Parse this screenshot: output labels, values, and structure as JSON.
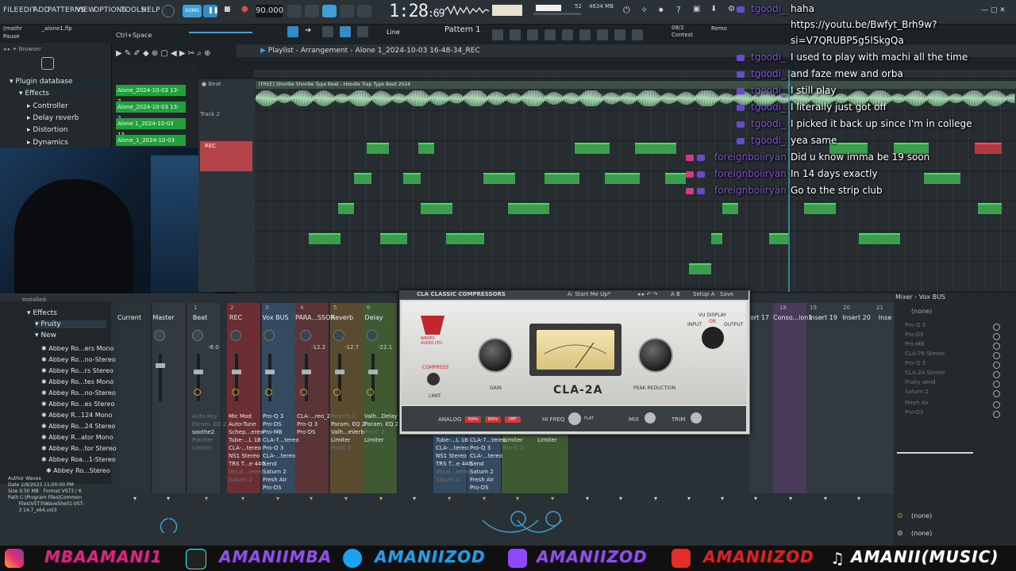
{
  "menu": [
    "FILE",
    "EDIT",
    "ADD",
    "PATTERNS",
    "VIEW",
    "OPTIONS",
    "TOOLS",
    "HELP"
  ],
  "song_label": "SONG",
  "tempo": "90.000",
  "time": {
    "main": "1:28",
    "ms": ":69"
  },
  "memory": {
    "mb": "4634 MB",
    "cpu": "52"
  },
  "project": {
    "user": "(mathr",
    "file": "_alone1.flp"
  },
  "status": "Pause",
  "hint": "Ctrl+Space",
  "toolbar": {
    "snap": "Line",
    "pattern": "Pattern 1",
    "contest": "Contest",
    "date": "08/2",
    "remote": "Remo"
  },
  "browser": {
    "title": "Browser",
    "items": [
      "Plugin database",
      "Effects",
      "Controller",
      "Delay reverb",
      "Distortion",
      "Dynamics"
    ]
  },
  "clips": [
    "Alone_2024-10-03 13-2...",
    "Alone_2024-10-03 13-2...",
    "Alone 1_2024-10-03 13...",
    "Alone_1_2024-10-03 11..."
  ],
  "playlist": {
    "title": "Playlist - Arrangement",
    "file": "Alone 1_2024-10-03 16-48-34_REC",
    "track_beat": "Beat",
    "track2": "Track 2",
    "rec_label": "REC",
    "audio_name": "[FREE] Shordie Shordie Type Beat - Hoodie  Trap Type Beat 2024"
  },
  "chat": [
    {
      "name": "tgoodi_",
      "msg": "haha"
    },
    {
      "name": "",
      "msg": "https://youtu.be/Bwfyt_Brh9w?"
    },
    {
      "name": "",
      "msg": "si=V7QRUBP5g5lSkgQa"
    },
    {
      "name": "tgoodi_",
      "msg": "I used to play with machi all the time"
    },
    {
      "name": "tgoodi_",
      "msg": "and faze mew and orba"
    },
    {
      "name": "tgoodi_",
      "msg": "I still play"
    },
    {
      "name": "tgoodi_",
      "msg": "I literally just got off"
    },
    {
      "name": "tgoodi_",
      "msg": "I picked it back up since I'm in college"
    },
    {
      "name": "tgoodi_",
      "msg": "yea same"
    },
    {
      "name": "foreignboiiryan",
      "msg": "Did u know imma be 19 soon"
    },
    {
      "name": "foreignboiiryan",
      "msg": "In 14 days exactly"
    },
    {
      "name": "foreignboiiryan",
      "msg": "Go to the strip club"
    }
  ],
  "plugin_tree": {
    "root": "Installed",
    "items": [
      "Effects",
      "Fruity",
      "New",
      "Abbey Ro...ers Mono",
      "Abbey Ro...no-Stereo",
      "Abbey Ro...rs Stereo",
      "Abbey Ro...tes Mono",
      "Abbey Ro...no-Stereo",
      "Abbey Ro...es Stereo",
      "Abbey R...124 Mono",
      "Abbey Ro...24 Stereo",
      "Abbey R...ator Mono",
      "Abbey Ro...tor Stereo",
      "Abbey Roa...1-Stereo",
      "Abbey Ro...Stereo"
    ]
  },
  "file_info": {
    "author_label": "Author",
    "author": "Waves",
    "date_label": "Date",
    "date": "2/8/2023 11:00:00 PM",
    "size_label": "Size",
    "size": "9.50 MB",
    "format_label": "Format",
    "format": "VST3 / 6",
    "path_label": "Path",
    "path1": "C:\\Program Files\\Common",
    "path2": "Files\\VST3\\WaveShell1-VST-",
    "path3": "3 14.7_x64.vst3"
  },
  "mixer": {
    "title": "Mixer - Vox BUS",
    "strips": [
      {
        "num": "",
        "name": "Current"
      },
      {
        "num": "",
        "name": "Master"
      },
      {
        "num": "1",
        "name": "Beat"
      },
      {
        "num": "2",
        "name": "REC"
      },
      {
        "num": "3",
        "name": "Vox BUS"
      },
      {
        "num": "4",
        "name": "PARA...SSOR"
      },
      {
        "num": "5",
        "name": "Reverb"
      },
      {
        "num": "6",
        "name": "Delay"
      }
    ],
    "right_strips": [
      {
        "num": "",
        "name": "ert 17"
      },
      {
        "num": "18",
        "name": "Conso...ion1"
      },
      {
        "num": "19",
        "name": "Insert 19"
      },
      {
        "num": "20",
        "name": "Insert 20"
      },
      {
        "num": "21",
        "name": "Inse"
      }
    ],
    "levels": [
      "-8.0",
      "-12.2",
      "-12.7",
      "-22.1"
    ],
    "fx_cols": [
      {
        "items": [
          "Auto-Key",
          "Param. EQ 2",
          "soothe2",
          "Patcher",
          "Limiter"
        ]
      },
      {
        "items": [
          "Mic Mod",
          "Auto-Tune",
          "Schep...ereo",
          "Tube-...L 1B",
          "CLA-...tereo",
          "NS1 Stereo",
          "TRS T...e 440",
          "Vocal...tereo",
          "Saturn 2"
        ]
      },
      {
        "items": [
          "Pro-Q 3",
          "Pro-DS",
          "Pro-MB",
          "CLA-7...tereo",
          "Pro-Q 3",
          "CLA-...tereo",
          "Send",
          "Saturn 2",
          "Fresh Air",
          "Pro-DS"
        ]
      },
      {
        "items": [
          "CLA-...reo_2",
          "Pro-Q 3",
          "Pro-DS"
        ]
      },
      {
        "items": [
          "Reverb 2",
          "Param. EQ 2",
          "Valh...eVerb",
          "Limiter",
          "Pro-C 2"
        ]
      },
      {
        "items": [
          "Valh...Delay",
          "Param. EQ 2",
          "Pro-C 2",
          "Limiter"
        ]
      }
    ],
    "fx_cols2": [
      {
        "items": [
          "Tube-...L 1B",
          "CLA-...tereo",
          "NS1 Stereo",
          "TRS T...e 440",
          "Vocal...tereo",
          "Saturn 2"
        ]
      },
      {
        "items": [
          "CLA-7...tereo",
          "Pro-Q 3",
          "CLA-...tereo",
          "Send",
          "Saturn 2",
          "Fresh Air",
          "Pro-DS"
        ]
      },
      {
        "items": [
          "Limiter",
          "Pro-C 2"
        ]
      },
      {
        "items": [
          "Limiter"
        ]
      }
    ],
    "sends_right": [
      "Pro-Q 3",
      "Pro-DS",
      "Pro-MB",
      "CLA-76 Stereo",
      "Pro-Q 3",
      "CLA-2A Stereo",
      "Fruity send",
      "Saturn 2",
      "Fresh Air",
      "Pro-DS"
    ],
    "none": "(none)"
  },
  "plugin": {
    "title": "CLA CLASSIC COMPRESSORS",
    "preset": "A: Start Me Up*",
    "ab": "A B",
    "setup": "Setup A",
    "save": "Save",
    "brand": "WAVES AUDIO LTD.",
    "model": "CLA-2A",
    "compress": "COMPRESS",
    "limit": "LIMIT",
    "gain": "GAIN",
    "peak_reduction": "PEAK REDUCTION",
    "vu_display": "VU DISPLAY",
    "input": "INPUT",
    "or": "OR",
    "output": "OUTPUT",
    "analog": "ANALOG",
    "hz50": "50Hz",
    "hz60": "60Hz",
    "off": "OFF",
    "hi_freq": "HI FREQ",
    "flat": "FLAT",
    "mix": "MIX",
    "trim": "TRIM"
  },
  "banner": [
    {
      "text": "MBAAMANI1",
      "color": "pink"
    },
    {
      "text": "AMANIIMBA",
      "color": "purple"
    },
    {
      "text": "AMANIIZOD",
      "color": "blue"
    },
    {
      "text": "AMANIIZOD",
      "color": "purple"
    },
    {
      "text": "AMANIIZOD",
      "color": "red"
    },
    {
      "text": "AMANII(MUSIC)",
      "color": "white"
    }
  ]
}
